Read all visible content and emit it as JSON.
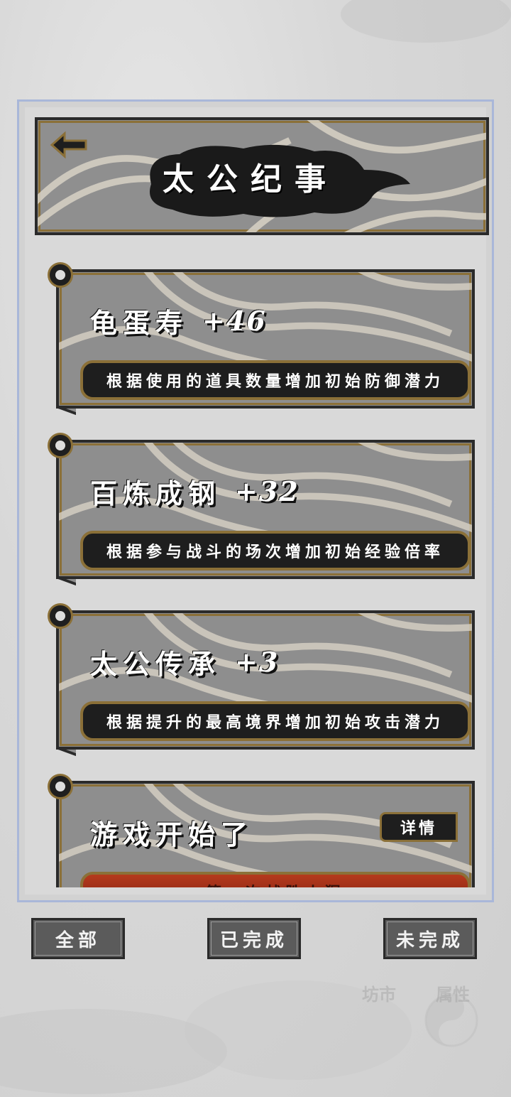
{
  "header": {
    "title": "太公纪事",
    "back_icon": "back-arrow-icon"
  },
  "records": [
    {
      "name": "龟蛋寿",
      "value": "+46",
      "description": "根据使用的道具数量增加初始防御潜力"
    },
    {
      "name": "百炼成钢",
      "value": "+32",
      "description": "根据参与战斗的场次增加初始经验倍率"
    },
    {
      "name": "太公传承",
      "value": "+3",
      "description": "根据提升的最高境界增加初始攻击潜力"
    },
    {
      "name": "游戏开始了",
      "value": "",
      "detail_label": "详情",
      "description": "第一次战胜火猩"
    }
  ],
  "tabs": {
    "all": "全部",
    "completed": "已完成",
    "incomplete": "未完成"
  },
  "background_nav": {
    "market": "坊市",
    "attributes": "属性"
  },
  "colors": {
    "frame_gold": "#8b7038",
    "panel_border": "#a9b7d9",
    "card_gray": "#8e8e8e",
    "dark": "#1e1e1e",
    "red_banner": "#b53a1d"
  }
}
